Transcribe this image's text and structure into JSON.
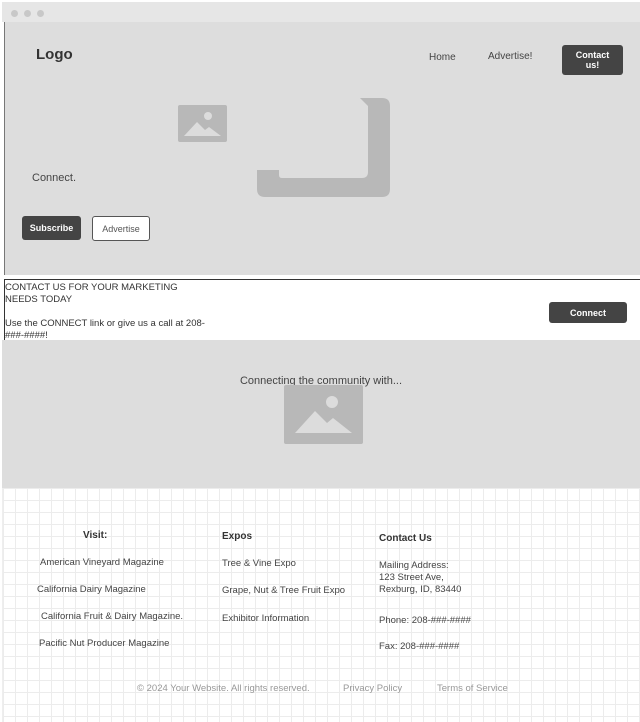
{
  "header": {
    "logo": "Logo",
    "nav": {
      "home": "Home",
      "advertise": "Advertise!",
      "contact_line1": "Contact",
      "contact_line2": "us!"
    }
  },
  "hero": {
    "tagline": "Connect.",
    "subscribe_label": "Subscribe",
    "advertise_label": "Advertise"
  },
  "contact_strip": {
    "title_line1": "CONTACT US FOR YOUR MARKETING",
    "title_line2": "NEEDS TODAY",
    "text_line1": "Use the CONNECT link or give us a call at 208-",
    "text_line2": "###-####!",
    "button_label": "Connect"
  },
  "community": {
    "title": "Connecting the community with..."
  },
  "footer": {
    "visit": {
      "heading": "Visit:",
      "items": [
        "American Vineyard Magazine",
        "California Dairy Magazine",
        "California Fruit & Dairy Magazine.",
        "Pacific Nut Producer Magazine"
      ]
    },
    "expos": {
      "heading": "Expos",
      "items": [
        "Tree & Vine Expo",
        "Grape, Nut & Tree Fruit Expo",
        "Exhibitor Information"
      ]
    },
    "contact": {
      "heading": "Contact Us",
      "address_label": "Mailing Address:",
      "address_line1": "123 Street Ave,",
      "address_line2": "Rexburg, ID, 83440",
      "phone": "Phone: 208-###-####",
      "fax": "Fax: 208-###-####"
    },
    "bottom": {
      "copyright": "© 2024 Your Website. All rights reserved.",
      "privacy": "Privacy Policy",
      "terms": "Terms of Service"
    }
  },
  "colors": {
    "panel_bg": "#dddddd",
    "button_dark": "#444444",
    "placeholder": "#b8b8b8"
  },
  "icons": [
    "image-placeholder-icon",
    "decorative-corner-shape"
  ]
}
